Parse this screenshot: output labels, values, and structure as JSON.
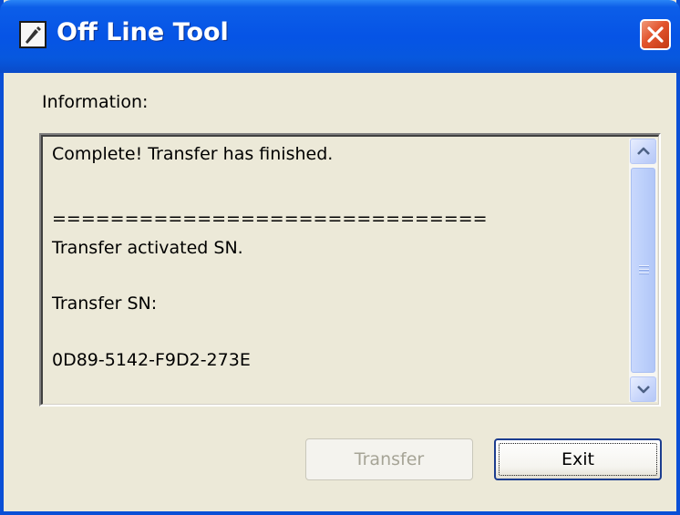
{
  "window": {
    "title": "Off Line Tool",
    "icons": {
      "app": "app-window-icon",
      "close": "close-icon"
    },
    "colors": {
      "titlebar": "#0654e6",
      "close_button": "#e2542d",
      "body": "#ece9d8"
    }
  },
  "information": {
    "label": "Information:",
    "lines": [
      "Complete! Transfer has finished.",
      "==============================",
      "Transfer activated SN.",
      "Transfer SN:",
      "0D89-5142-F9D2-273E"
    ]
  },
  "scrollbar": {
    "icons": {
      "up": "scroll-up-arrow-icon",
      "down": "scroll-down-arrow-icon"
    }
  },
  "buttons": {
    "transfer_label": "Transfer",
    "transfer_enabled": false,
    "exit_label": "Exit"
  }
}
